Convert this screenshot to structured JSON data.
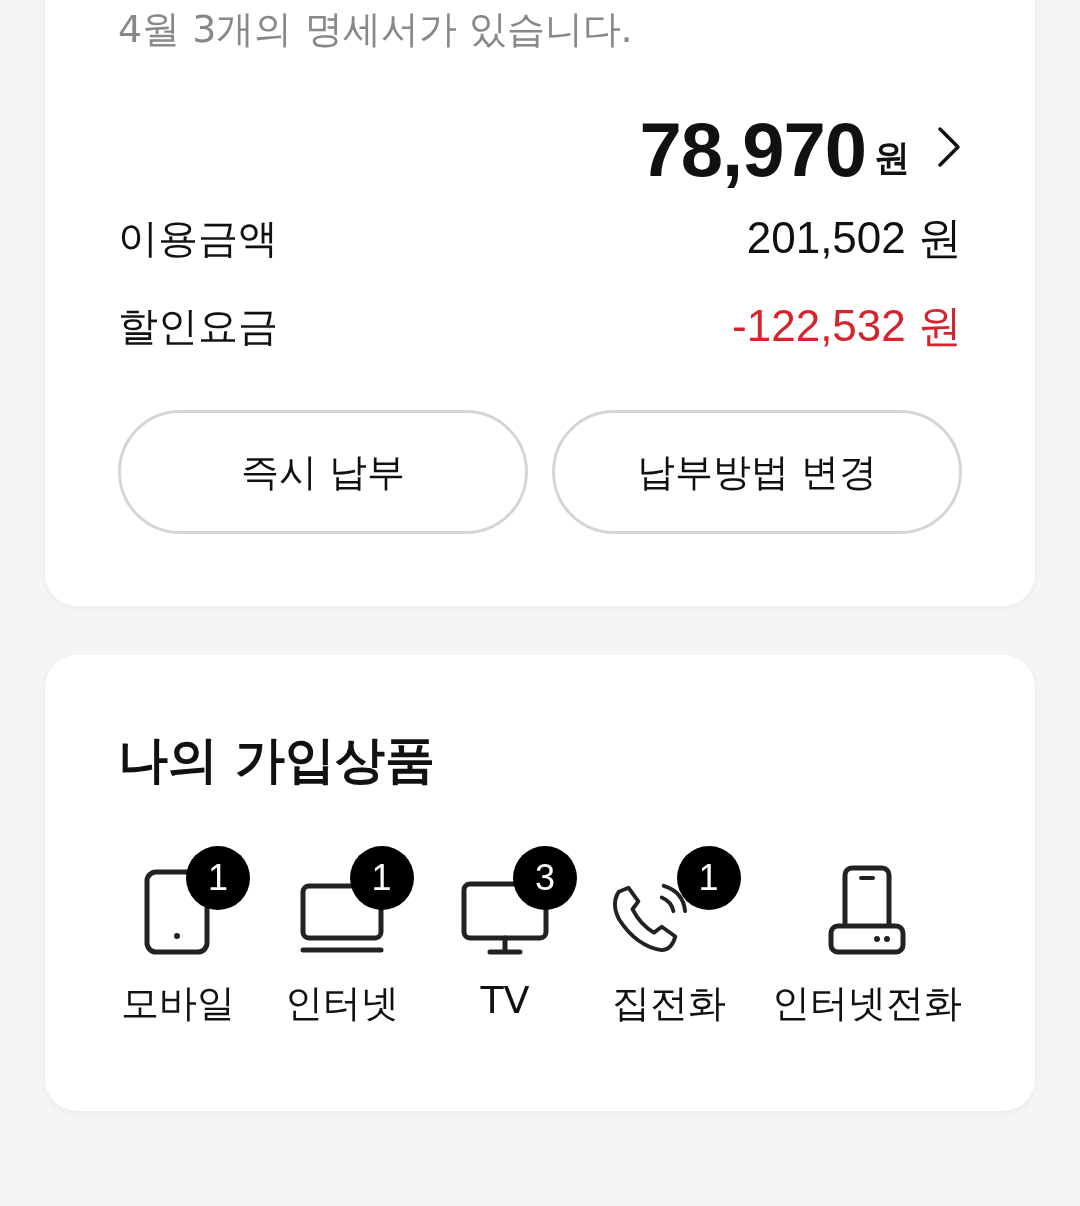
{
  "bill": {
    "notice": "4월 3개의 명세서가 있습니다.",
    "total": "78,970",
    "total_unit": "원",
    "rows": [
      {
        "label": "이용금액",
        "amount": "201,502",
        "unit": "원",
        "kind": "normal"
      },
      {
        "label": "할인요금",
        "amount": "-122,532",
        "unit": "원",
        "kind": "discount"
      }
    ],
    "buttons": [
      "즉시 납부",
      "납부방법 변경"
    ]
  },
  "products": {
    "title": "나의 가입상품",
    "items": [
      {
        "kind": "mobile",
        "label": "모바일",
        "badge": "1"
      },
      {
        "kind": "laptop",
        "label": "인터넷",
        "badge": "1"
      },
      {
        "kind": "tv",
        "label": "TV",
        "badge": "3"
      },
      {
        "kind": "phone",
        "label": "집전화",
        "badge": "1"
      },
      {
        "kind": "router",
        "label": "인터넷전화"
      }
    ]
  }
}
